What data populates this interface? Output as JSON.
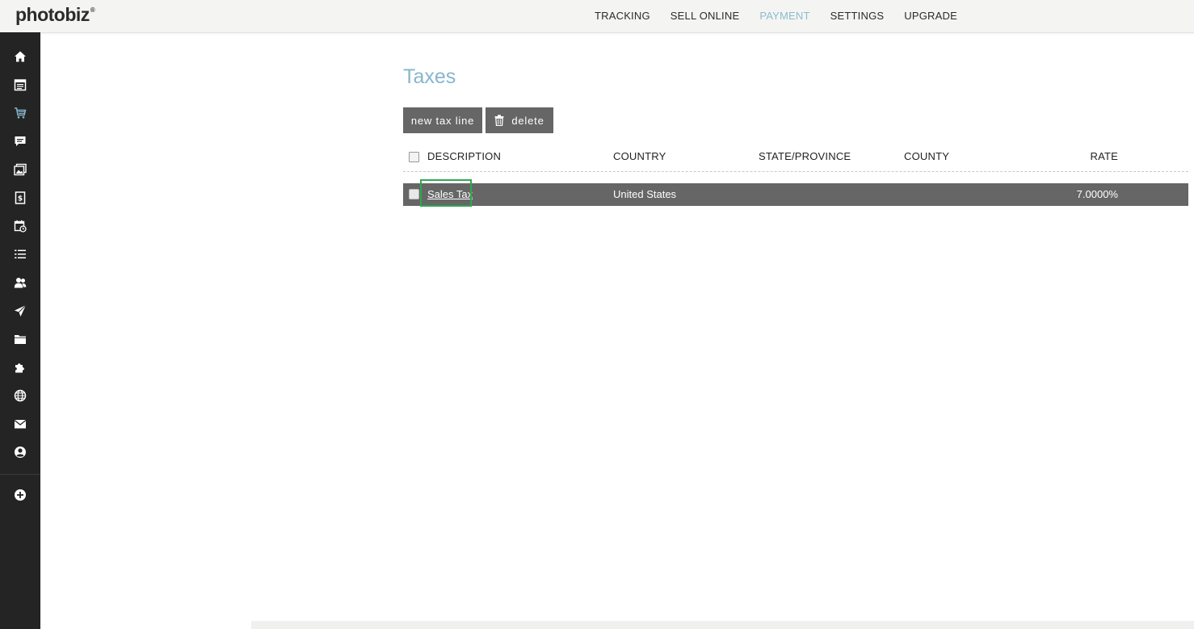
{
  "app": {
    "logo": "photobiz",
    "trademark": "®"
  },
  "nav": {
    "items": [
      {
        "label": "TRACKING",
        "active": false
      },
      {
        "label": "SELL ONLINE",
        "active": false
      },
      {
        "label": "PAYMENT",
        "active": true
      },
      {
        "label": "SETTINGS",
        "active": false
      },
      {
        "label": "UPGRADE",
        "active": false
      }
    ]
  },
  "sidebar": {
    "icons": [
      "home-icon",
      "calendar-list-icon",
      "cart-icon",
      "chat-icon",
      "gallery-icon",
      "invoice-icon",
      "booking-calendar-icon",
      "list-icon",
      "clients-icon",
      "send-icon",
      "folder-icon",
      "puzzle-icon",
      "globe-icon",
      "mail-icon",
      "account-icon",
      "add-icon"
    ],
    "active_icon": "cart-icon"
  },
  "page": {
    "title": "Taxes"
  },
  "toolbar": {
    "new_label": "new tax line",
    "delete_label": "delete"
  },
  "table": {
    "headers": {
      "description": "DESCRIPTION",
      "country": "COUNTRY",
      "state": "STATE/PROVINCE",
      "county": "COUNTY",
      "rate": "RATE"
    },
    "rows": [
      {
        "description": "Sales Tax",
        "country": "United States",
        "state": "",
        "county": "",
        "rate": "7.0000%"
      }
    ]
  },
  "colors": {
    "accent": "#86b7cc",
    "sidebar": "#242424",
    "button": "#666666",
    "highlight": "#2fa84f"
  }
}
